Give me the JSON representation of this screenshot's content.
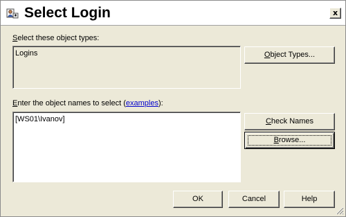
{
  "window": {
    "title": "Select Login",
    "close_glyph": "x"
  },
  "object_types": {
    "label_prefix": "",
    "label_accel": "S",
    "label_rest": "elect these object types:",
    "value": "Logins",
    "button_accel": "O",
    "button_rest": "bject Types..."
  },
  "object_names": {
    "label_accel": "E",
    "label_rest": "nter the object names to select (",
    "examples_link": "examples",
    "label_suffix": "):",
    "value": "[WS01\\Ivanov]"
  },
  "buttons": {
    "check_accel": "C",
    "check_rest": "heck Names",
    "browse_accel": "B",
    "browse_rest": "rowse...",
    "ok": "OK",
    "cancel": "Cancel",
    "help": "Help"
  },
  "icons": {
    "title": "select-user-icon",
    "close": "close-icon",
    "grip": "resize-grip-icon"
  },
  "colors": {
    "dialog_bg": "#ece9d8",
    "link": "#0000cc"
  }
}
